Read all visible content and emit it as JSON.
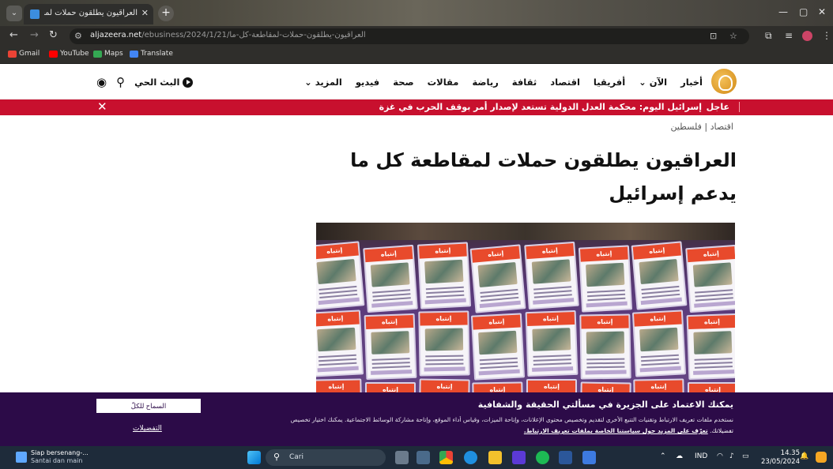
{
  "browser": {
    "tab_title": "العراقيون يطلقون حملات لمقاطعة",
    "url_domain": "aljazeera.net",
    "url_path": "/ebusiness/2024/1/21/العراقيون-يطلقون-حملات-لمقاطعة-كل-ما",
    "bookmarks": [
      {
        "label": "Gmail",
        "color": "#ea4335"
      },
      {
        "label": "YouTube",
        "color": "#ff0000"
      },
      {
        "label": "Maps",
        "color": "#34a853"
      },
      {
        "label": "Translate",
        "color": "#4285f4"
      }
    ]
  },
  "site": {
    "nav": [
      "أخبار",
      "الآن",
      "أفريقيا",
      "اقتصاد",
      "ثقافة",
      "رياضة",
      "مقالات",
      "صحة",
      "فيديو",
      "المزيد"
    ],
    "live_label": "البث الحي",
    "breaking_label": "عاجل",
    "breaking_text": "إسرائيل اليوم: محكمة العدل الدولية تستعد لإصدار أمر بوقف الحرب في غزة",
    "breadcrumb": "اقتصاد | فلسطين",
    "headline": "العراقيون يطلقون حملات لمقاطعة كل ما يدعم إسرائيل",
    "card_label": "إنتباه",
    "accent_red": "#c8102e",
    "banner_purple": "#2c0b48"
  },
  "cookie": {
    "title": "يمكنك الاعتماد على الجزيرة في مسألتي الحقيقة والشفافية",
    "body": "نستخدم ملفات تعريف الارتباط وتقنيات التتبع الأخرى لتقديم وتخصيص محتوى الإعلانات، وإتاحة الميزات، وقياس أداء الموقع، وإتاحة مشاركة الوسائط الاجتماعية. يمكنك اختيار تخصيص",
    "link_prefix": "تفضيلاتك.",
    "link_text": "تعرّف على المزيد حول سياستنا الخاصة بملفات تعريف الارتباط.",
    "allow_button": "السماح للكلّ",
    "preferences_button": "التفضيلات"
  },
  "taskbar": {
    "weather_line1": "Siap bersenang-...",
    "weather_line2": "Santai dan main",
    "search_placeholder": "Cari",
    "language": "IND",
    "time": "14.35",
    "date": "23/05/2024"
  }
}
